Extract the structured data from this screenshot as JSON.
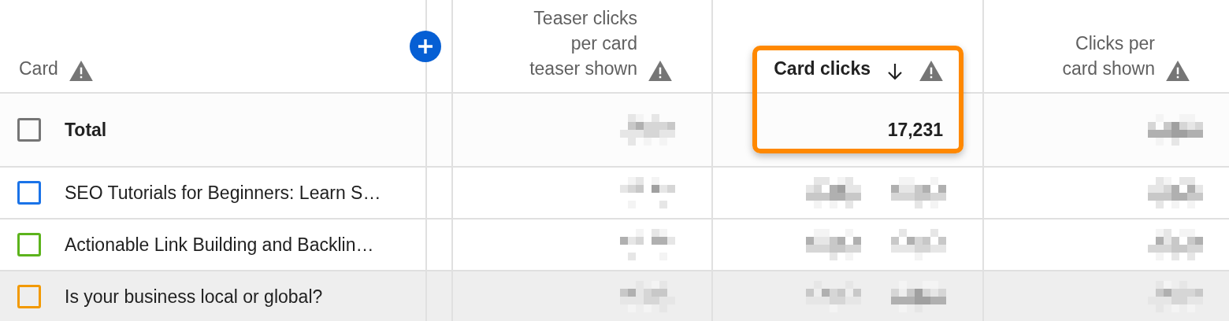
{
  "columns": [
    {
      "lines": [
        "Card"
      ],
      "warning": true,
      "sorted": false,
      "highlighted": false
    },
    {
      "lines": [
        "Teaser clicks",
        "per card",
        "teaser shown"
      ],
      "warning": true,
      "sorted": false,
      "highlighted": false
    },
    {
      "lines": [
        "Card clicks"
      ],
      "warning": true,
      "sorted": true,
      "highlighted": true
    },
    {
      "lines": [
        "Clicks per",
        "card shown"
      ],
      "warning": true,
      "sorted": false,
      "highlighted": false
    }
  ],
  "rows": [
    {
      "kind": "total",
      "label": "Total",
      "checked": false,
      "color": "#757575",
      "highlighted": false,
      "card_clicks": "17,231"
    },
    {
      "kind": "card",
      "label": "SEO Tutorials for Beginners: Learn S…",
      "checked": false,
      "color": "#1a73e8",
      "highlighted": false
    },
    {
      "kind": "card",
      "label": "Actionable Link Building and Backlin…",
      "checked": false,
      "color": "#5cb31c",
      "highlighted": false
    },
    {
      "kind": "card",
      "label": "Is your business local or global?",
      "checked": false,
      "color": "#f29900",
      "highlighted": true
    }
  ]
}
